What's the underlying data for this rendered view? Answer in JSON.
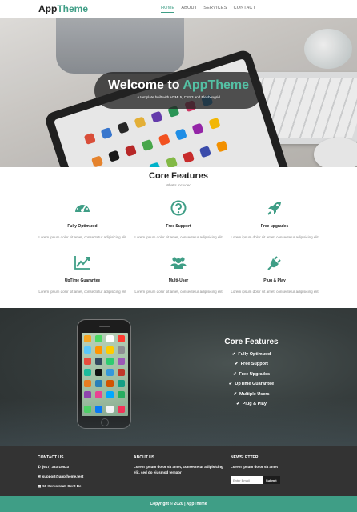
{
  "nav": {
    "logo_main": "App",
    "logo_accent": "Theme",
    "links": [
      "HOME",
      "ABOUT",
      "SERVICES",
      "CONTACT"
    ]
  },
  "hero": {
    "title_main": "Welcome to ",
    "title_accent": "AppTheme",
    "subtitle": "A template built with HTML5, CSS3 and Flexboxgrid"
  },
  "features": {
    "title": "Core Features",
    "subtitle": "What's Included",
    "items": [
      {
        "icon": "dashboard-icon",
        "name": "Fully Optimized",
        "desc": "Lorem ipsum dolor sit amet, consectetur adipisicing elit"
      },
      {
        "icon": "question-icon",
        "name": "Free Support",
        "desc": "Lorem ipsum dolor sit amet, consectetur adipisicing elit"
      },
      {
        "icon": "rocket-icon",
        "name": "Free upgrades",
        "desc": "Lorem ipsum dolor sit amet, consectetur adipisicing elit"
      },
      {
        "icon": "line-chart-icon",
        "name": "UpTime Guarantee",
        "desc": "Lorem ipsum dolor sit amet, consectetur adipisicing elit"
      },
      {
        "icon": "users-icon",
        "name": "Multi-User",
        "desc": "Lorem ipsum dolor sit amet, consectetur adipisicing elit"
      },
      {
        "icon": "plug-icon",
        "name": "Plug & Play",
        "desc": "Lorem ipsum dolor sit amet, consectetur adipisicing elit"
      }
    ],
    "accent_color": "#3f9e86"
  },
  "showcase": {
    "title": "Core Features",
    "items": [
      "Fully Optimized",
      "Free Support",
      "Free Upgrades",
      "UpTime Guarantee",
      "Multiple Users",
      "Plug & Play"
    ]
  },
  "footer": {
    "contact": {
      "heading": "CONTACT US",
      "phone": "(617) 333-15633",
      "email": "support@apptheme.test",
      "address": "50 Kerkstraat, Gent Be"
    },
    "about": {
      "heading": "ABOUT US",
      "text": "Lorem ipsum dolor sit amet, consectetur adipisicing elit, sed do eiusmod tempor"
    },
    "newsletter": {
      "heading": "NEWSLETTER",
      "text": "Lorem ipsum dolor sit amet",
      "placeholder": "Enter Email",
      "button": "Submit"
    },
    "copyright": "Copyright © 2020 | AppTheme"
  }
}
